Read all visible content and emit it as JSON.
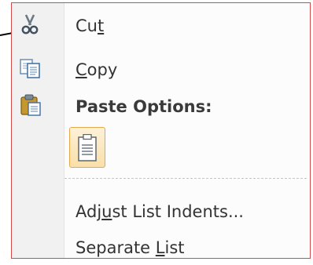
{
  "menu": {
    "items": [
      {
        "pre": "Cu",
        "u": "t",
        "post": "",
        "icon": "scissors-icon"
      },
      {
        "pre": "",
        "u": "C",
        "post": "opy",
        "icon": "copy-icon"
      },
      {
        "pre": "Paste Options:",
        "u": "",
        "post": "",
        "icon": "clipboard-icon"
      },
      {
        "pre": "Adj",
        "u": "u",
        "post": "st List Indents...",
        "icon": ""
      },
      {
        "pre": "Separate ",
        "u": "L",
        "post": "ist",
        "icon": ""
      }
    ],
    "paste_option_icon": "paste-keep-text-icon",
    "border_color": "#d24a4a",
    "accent_color": "#e5a94a"
  }
}
